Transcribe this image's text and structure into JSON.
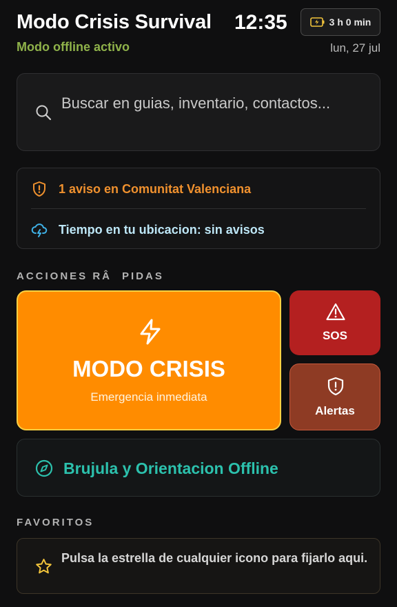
{
  "header": {
    "title": "Modo Crisis Survival",
    "status": "Modo offline activo",
    "time": "12:35",
    "battery": "3 h 0 min",
    "date": "lun, 27 jul"
  },
  "search": {
    "placeholder": "Buscar en guias, inventario, contactos..."
  },
  "alerts": {
    "regional": "1 aviso en Comunitat Valenciana",
    "weather": "Tiempo en tu ubicacion: sin avisos"
  },
  "quick_actions": {
    "section_title": "ACCIONES RÂPIDAS",
    "crisis_title": "MODO CRISIS",
    "crisis_subtitle": "Emergencia inmediata",
    "sos_label": "SOS",
    "alerts_label": "Alertas",
    "compass_label": "Brujula y Orientacion Offline"
  },
  "favorites": {
    "section_title": "FAVORITOS",
    "empty_message": "Pulsa la estrella de cualquier icono para fijarlo aqui."
  },
  "colors": {
    "background": "#0f0f10",
    "status_green": "#8fb24a",
    "warning_orange": "#f0912e",
    "crisis_orange": "#ff8c00",
    "crisis_border": "#ffd142",
    "sos_red": "#b42020",
    "alerts_brown": "#8e3b24",
    "compass_teal": "#2cc1ad",
    "weather_blue": "#bde6f6"
  },
  "icons": {
    "battery": "battery-charging-icon",
    "search": "search-icon",
    "regional_alert": "shield-alert-icon",
    "weather": "cloud-lightning-icon",
    "crisis": "lightning-icon",
    "sos": "warning-triangle-icon",
    "alerts": "shield-alert-icon",
    "compass": "compass-icon",
    "favorite": "star-icon"
  }
}
